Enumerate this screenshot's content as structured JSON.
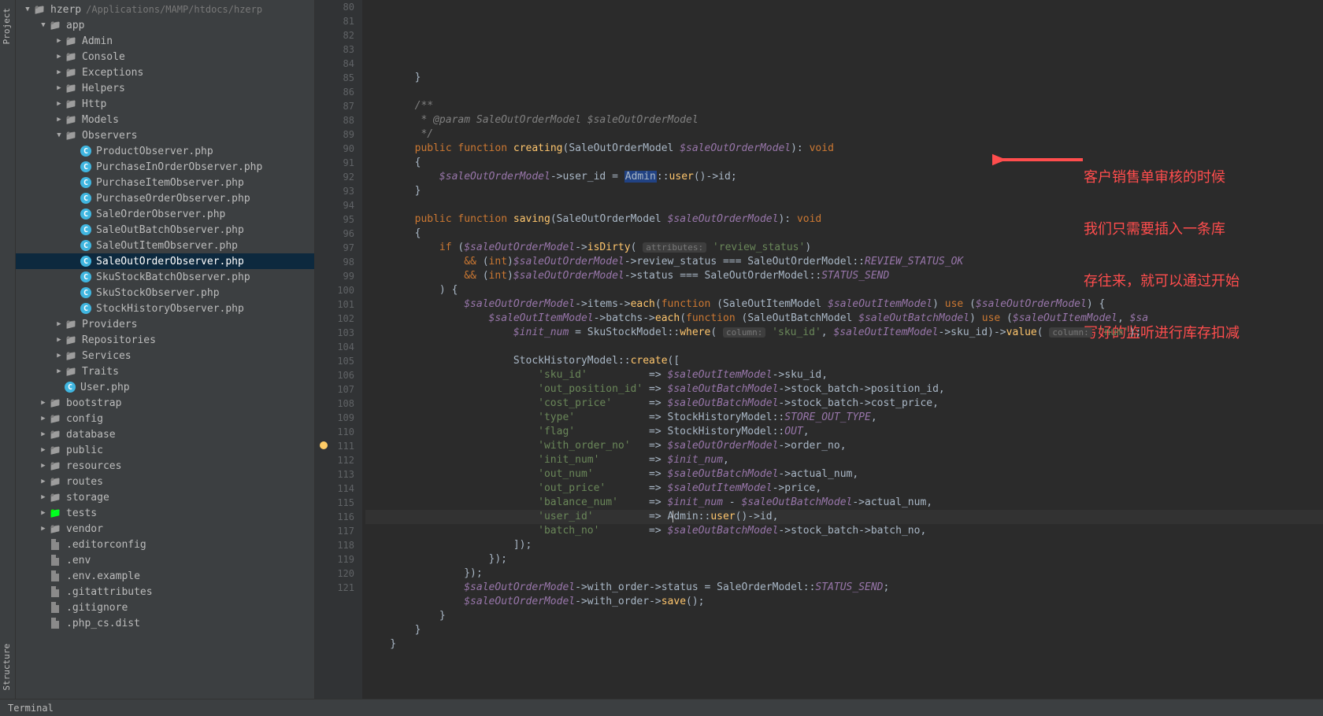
{
  "toolstrip": {
    "top": "Project",
    "bottom": "Structure"
  },
  "statusbar": {
    "terminal": "Terminal"
  },
  "annotation": {
    "line1": "客户销售单审核的时候",
    "line2": "我们只需要插入一条库",
    "line3": "存往来，就可以通过开始",
    "line4": "写好的监听进行库存扣减"
  },
  "tree": [
    {
      "d": 0,
      "t": "open",
      "i": "dir",
      "label": "hzerp",
      "hint": "/Applications/MAMP/htdocs/hzerp"
    },
    {
      "d": 1,
      "t": "open",
      "i": "dir",
      "label": "app"
    },
    {
      "d": 2,
      "t": "closed",
      "i": "dir",
      "label": "Admin"
    },
    {
      "d": 2,
      "t": "closed",
      "i": "dir",
      "label": "Console"
    },
    {
      "d": 2,
      "t": "closed",
      "i": "dir",
      "label": "Exceptions"
    },
    {
      "d": 2,
      "t": "closed",
      "i": "dir",
      "label": "Helpers"
    },
    {
      "d": 2,
      "t": "closed",
      "i": "dir",
      "label": "Http"
    },
    {
      "d": 2,
      "t": "closed",
      "i": "dir",
      "label": "Models"
    },
    {
      "d": 2,
      "t": "open",
      "i": "dir",
      "label": "Observers"
    },
    {
      "d": 3,
      "t": "none",
      "i": "c",
      "label": "ProductObserver.php"
    },
    {
      "d": 3,
      "t": "none",
      "i": "c",
      "label": "PurchaseInOrderObserver.php"
    },
    {
      "d": 3,
      "t": "none",
      "i": "c",
      "label": "PurchaseItemObserver.php"
    },
    {
      "d": 3,
      "t": "none",
      "i": "c",
      "label": "PurchaseOrderObserver.php"
    },
    {
      "d": 3,
      "t": "none",
      "i": "c",
      "label": "SaleOrderObserver.php"
    },
    {
      "d": 3,
      "t": "none",
      "i": "c",
      "label": "SaleOutBatchObserver.php"
    },
    {
      "d": 3,
      "t": "none",
      "i": "c",
      "label": "SaleOutItemObserver.php"
    },
    {
      "d": 3,
      "t": "none",
      "i": "c",
      "label": "SaleOutOrderObserver.php",
      "selected": true
    },
    {
      "d": 3,
      "t": "none",
      "i": "c",
      "label": "SkuStockBatchObserver.php"
    },
    {
      "d": 3,
      "t": "none",
      "i": "c",
      "label": "SkuStockObserver.php"
    },
    {
      "d": 3,
      "t": "none",
      "i": "c",
      "label": "StockHistoryObserver.php"
    },
    {
      "d": 2,
      "t": "closed",
      "i": "dir",
      "label": "Providers"
    },
    {
      "d": 2,
      "t": "closed",
      "i": "dir",
      "label": "Repositories"
    },
    {
      "d": 2,
      "t": "closed",
      "i": "dir",
      "label": "Services"
    },
    {
      "d": 2,
      "t": "closed",
      "i": "dir",
      "label": "Traits"
    },
    {
      "d": 2,
      "t": "none",
      "i": "c",
      "label": "User.php"
    },
    {
      "d": 1,
      "t": "closed",
      "i": "dir",
      "label": "bootstrap"
    },
    {
      "d": 1,
      "t": "closed",
      "i": "dir",
      "label": "config"
    },
    {
      "d": 1,
      "t": "closed",
      "i": "dir",
      "label": "database"
    },
    {
      "d": 1,
      "t": "closed",
      "i": "dir",
      "label": "public"
    },
    {
      "d": 1,
      "t": "closed",
      "i": "dir",
      "label": "resources"
    },
    {
      "d": 1,
      "t": "closed",
      "i": "dir",
      "label": "routes"
    },
    {
      "d": 1,
      "t": "closed",
      "i": "dir",
      "label": "storage"
    },
    {
      "d": 1,
      "t": "closed",
      "i": "dirtests",
      "label": "tests"
    },
    {
      "d": 1,
      "t": "closed",
      "i": "dir",
      "label": "vendor"
    },
    {
      "d": 1,
      "t": "none",
      "i": "txt",
      "label": ".editorconfig"
    },
    {
      "d": 1,
      "t": "none",
      "i": "txt",
      "label": ".env"
    },
    {
      "d": 1,
      "t": "none",
      "i": "txt",
      "label": ".env.example"
    },
    {
      "d": 1,
      "t": "none",
      "i": "txt",
      "label": ".gitattributes"
    },
    {
      "d": 1,
      "t": "none",
      "i": "txt",
      "label": ".gitignore"
    },
    {
      "d": 1,
      "t": "none",
      "i": "txt",
      "label": ".php_cs.dist"
    }
  ],
  "code": {
    "start": 80,
    "highlight": 111,
    "bulb": 111,
    "lines": [
      "        }",
      "",
      "        /**",
      "         * @param SaleOutOrderModel $saleOutOrderModel",
      "         */",
      "        public function creating(SaleOutOrderModel $saleOutOrderModel): void",
      "        {",
      "            $saleOutOrderModel->user_id = Admin::user()->id;",
      "        }",
      "",
      "        public function saving(SaleOutOrderModel $saleOutOrderModel): void",
      "        {",
      "            if ($saleOutOrderModel->isDirty( attributes: 'review_status')",
      "                && (int)$saleOutOrderModel->review_status === SaleOutOrderModel::REVIEW_STATUS_OK",
      "                && (int)$saleOutOrderModel->status === SaleOutOrderModel::STATUS_SEND",
      "            ) {",
      "                $saleOutOrderModel->items->each(function (SaleOutItemModel $saleOutItemModel) use ($saleOutOrderModel) {",
      "                    $saleOutItemModel->batchs->each(function (SaleOutBatchModel $saleOutBatchModel) use ($saleOutItemModel, $sa",
      "                        $init_num = SkuStockModel::where( column: 'sku_id', $saleOutItemModel->sku_id)->value( column: 'num');",
      "",
      "                        StockHistoryModel::create([",
      "                            'sku_id'          => $saleOutItemModel->sku_id,",
      "                            'out_position_id' => $saleOutBatchModel->stock_batch->position_id,",
      "                            'cost_price'      => $saleOutBatchModel->stock_batch->cost_price,",
      "                            'type'            => StockHistoryModel::STORE_OUT_TYPE,",
      "                            'flag'            => StockHistoryModel::OUT,",
      "                            'with_order_no'   => $saleOutOrderModel->order_no,",
      "                            'init_num'        => $init_num,",
      "                            'out_num'         => $saleOutBatchModel->actual_num,",
      "                            'out_price'       => $saleOutItemModel->price,",
      "                            'balance_num'     => $init_num - $saleOutBatchModel->actual_num,",
      "                            'user_id'         => Admin::user()->id,",
      "                            'batch_no'        => $saleOutBatchModel->stock_batch->batch_no,",
      "                        ]);",
      "                    });",
      "                });",
      "                $saleOutOrderModel->with_order->status = SaleOrderModel::STATUS_SEND;",
      "                $saleOutOrderModel->with_order->save();",
      "            }",
      "        }",
      "    }",
      ""
    ]
  }
}
